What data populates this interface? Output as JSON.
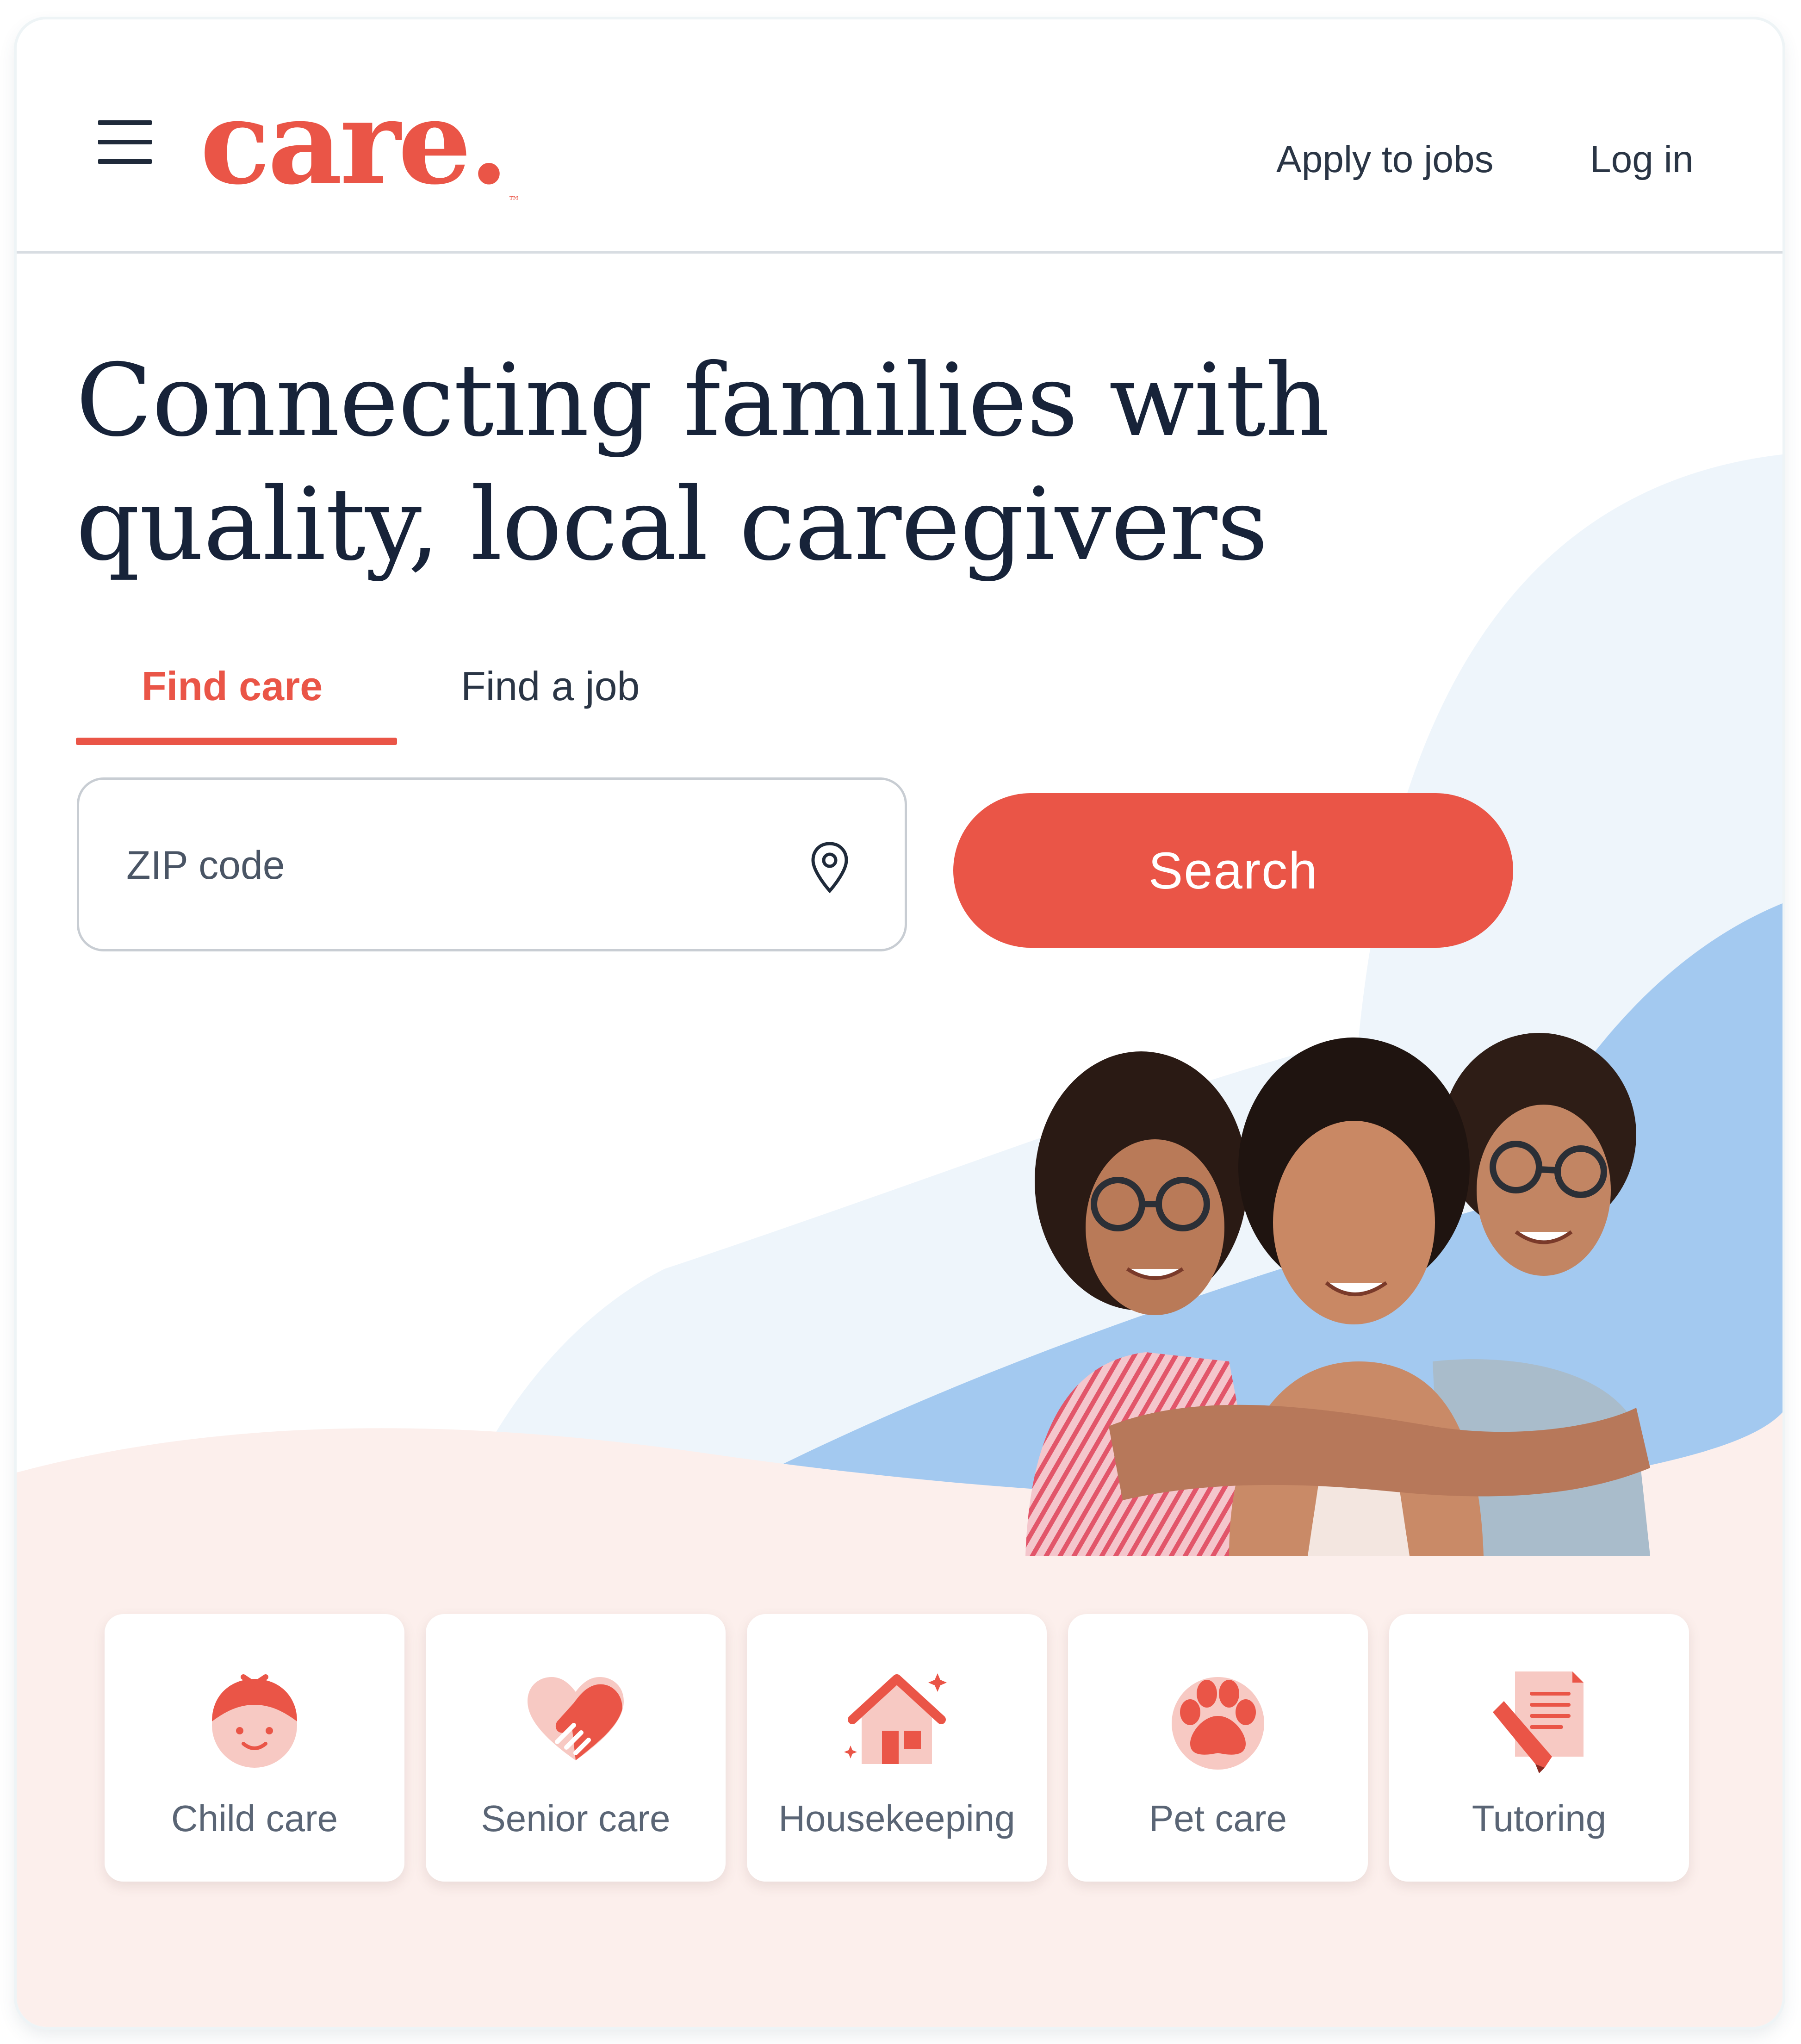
{
  "header": {
    "logo_text": "care.",
    "logo_tm": "™",
    "apply_link": "Apply to jobs",
    "login_link": "Log in"
  },
  "hero": {
    "headline_line1": "Connecting families with",
    "headline_line2": "quality, local caregivers"
  },
  "tabs": [
    {
      "label": "Find care",
      "active": true
    },
    {
      "label": "Find a job",
      "active": false
    }
  ],
  "search": {
    "zip_placeholder": "ZIP code",
    "zip_value": "",
    "button_label": "Search"
  },
  "categories": [
    {
      "label": "Child care",
      "icon": "child-face-icon"
    },
    {
      "label": "Senior care",
      "icon": "heart-handshake-icon"
    },
    {
      "label": "Housekeeping",
      "icon": "house-sparkle-icon"
    },
    {
      "label": "Pet care",
      "icon": "paw-icon"
    },
    {
      "label": "Tutoring",
      "icon": "document-pencil-icon"
    }
  ],
  "colors": {
    "brand": "#ea5547",
    "text_dark": "#172339",
    "blob_light_blue": "#eef5fb",
    "blob_blue": "#a3c9f0",
    "pink_wave": "#fcefec"
  }
}
